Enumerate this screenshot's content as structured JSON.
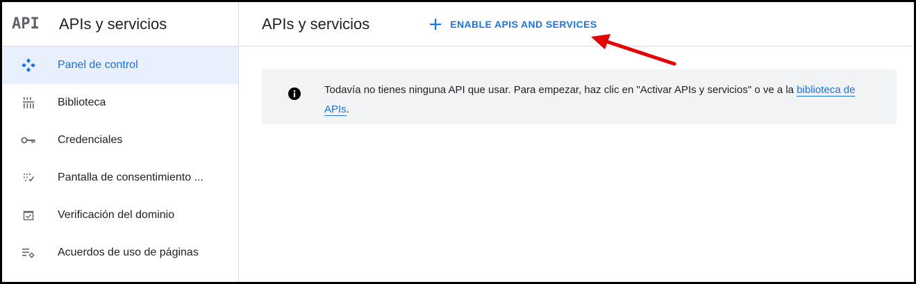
{
  "sidebar": {
    "logo": "API",
    "title": "APIs y servicios",
    "items": [
      {
        "label": "Panel de control",
        "icon": "dashboard-icon",
        "active": true
      },
      {
        "label": "Biblioteca",
        "icon": "library-icon"
      },
      {
        "label": "Credenciales",
        "icon": "key-icon"
      },
      {
        "label": "Pantalla de consentimiento ...",
        "icon": "consent-screen-icon"
      },
      {
        "label": "Verificación del dominio",
        "icon": "domain-check-icon"
      },
      {
        "label": "Acuerdos de uso de páginas",
        "icon": "settings-list-icon"
      }
    ]
  },
  "main": {
    "title": "APIs y servicios",
    "enable_button": "ENABLE APIS AND SERVICES",
    "info": {
      "text": "Todavía no tienes ninguna API que usar. Para empezar, haz clic en \"Activar APIs y servicios\" o ve a la ",
      "link": "biblioteca de APIs",
      "suffix": "."
    }
  },
  "colors": {
    "accent": "#1a73e8",
    "active_bg": "#e8f0fe",
    "info_bg": "#f1f3f4",
    "annotation_arrow": "#e50000"
  }
}
